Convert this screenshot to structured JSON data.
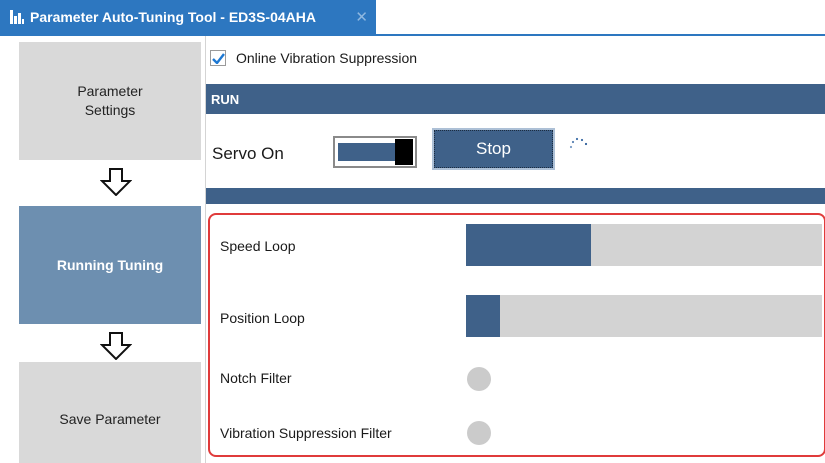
{
  "window": {
    "title": "Parameter Auto-Tuning Tool - ED3S-04AHA",
    "close_glyph": "✕"
  },
  "steps": [
    {
      "label": "Parameter Settings",
      "state": "inactive"
    },
    {
      "label": "Running Tuning",
      "state": "active"
    },
    {
      "label": "Save Parameter",
      "state": "inactive"
    }
  ],
  "options": {
    "online_vibration_suppression": {
      "label": "Online Vibration Suppression",
      "checked": true
    }
  },
  "run": {
    "header": "RUN",
    "servo_label": "Servo On",
    "servo_on": true,
    "stop_label": "Stop",
    "busy_indicator": "loading-spinner"
  },
  "tuning": {
    "speed_loop": {
      "label": "Speed Loop",
      "progress": 0.35
    },
    "position_loop": {
      "label": "Position Loop",
      "progress": 0.095
    },
    "notch_filter": {
      "label": "Notch Filter",
      "active": false
    },
    "vibration_filter": {
      "label": "Vibration Suppression Filter",
      "active": false
    }
  },
  "colors": {
    "accent": "#3f6189",
    "title_tab": "#2d77c0",
    "active_step": "#6d8fb0",
    "highlight_border": "#e03b3b"
  }
}
